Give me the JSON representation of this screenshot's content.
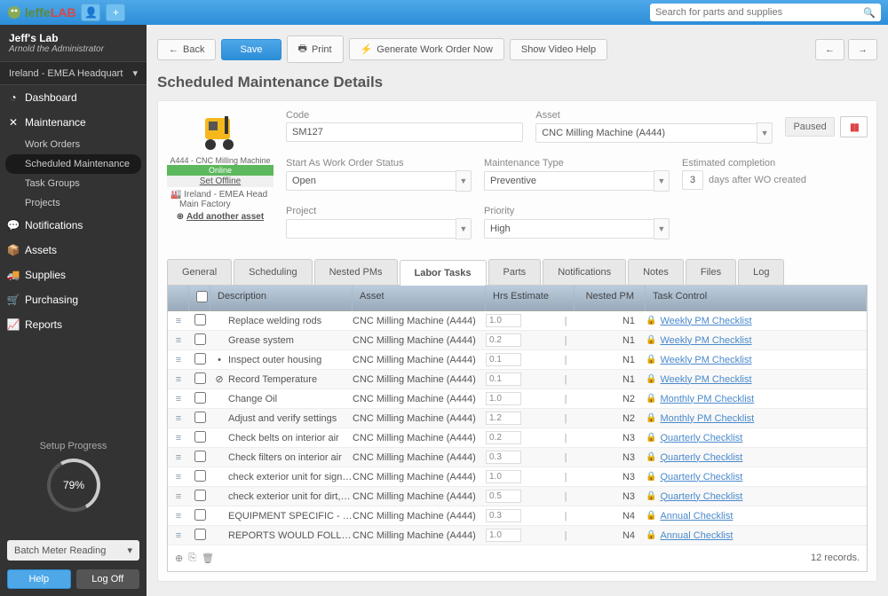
{
  "topbar": {
    "search_placeholder": "Search for parts and supplies"
  },
  "sidebar": {
    "lab_name": "Jeff's Lab",
    "admin": "Arnold the Administrator",
    "location": "Ireland - EMEA Headquart",
    "nav": [
      {
        "label": "Dashboard"
      },
      {
        "label": "Maintenance"
      },
      {
        "label": "Notifications"
      },
      {
        "label": "Assets"
      },
      {
        "label": "Supplies"
      },
      {
        "label": "Purchasing"
      },
      {
        "label": "Reports"
      }
    ],
    "maint_sub": [
      {
        "label": "Work Orders"
      },
      {
        "label": "Scheduled Maintenance"
      },
      {
        "label": "Task Groups"
      },
      {
        "label": "Projects"
      }
    ],
    "setup_label": "Setup Progress",
    "setup_pct": "79%",
    "batch_meter": "Batch Meter Reading",
    "help": "Help",
    "logoff": "Log Off"
  },
  "toolbar": {
    "back": "Back",
    "save": "Save",
    "print": "Print",
    "gen": "Generate Work Order Now",
    "video": "Show Video Help"
  },
  "page_title": "Scheduled Maintenance Details",
  "asset_preview": {
    "name": "A444 - CNC Milling Machine",
    "status": "Online",
    "set_offline": "Set Offline",
    "tree1": "Ireland - EMEA Head",
    "tree2": "Main Factory",
    "add": "Add another asset"
  },
  "fields": {
    "code_label": "Code",
    "code": "SM127",
    "asset_label": "Asset",
    "asset": "CNC Milling Machine (A444)",
    "paused": "Paused",
    "start_label": "Start As Work Order Status",
    "start": "Open",
    "maint_label": "Maintenance Type",
    "maint": "Preventive",
    "est_label": "Estimated completion",
    "est_days": "3",
    "est_after": "days after WO created",
    "project_label": "Project",
    "project": "",
    "priority_label": "Priority",
    "priority": "High"
  },
  "tabs": [
    "General",
    "Scheduling",
    "Nested PMs",
    "Labor Tasks",
    "Parts",
    "Notifications",
    "Notes",
    "Files",
    "Log"
  ],
  "active_tab": 3,
  "table": {
    "headers": {
      "desc": "Description",
      "asset": "Asset",
      "hrs": "Hrs Estimate",
      "np": "Nested PM",
      "tc": "Task Control"
    },
    "rows": [
      {
        "desc": "Replace welding rods",
        "asset": "CNC Milling Machine (A444)",
        "hrs": "1.0",
        "np": "N1",
        "tc": "Weekly PM Checklist",
        "extra": ""
      },
      {
        "desc": "Grease system",
        "asset": "CNC Milling Machine (A444)",
        "hrs": "0.2",
        "np": "N1",
        "tc": "Weekly PM Checklist",
        "extra": ""
      },
      {
        "desc": "Inspect outer housing",
        "asset": "CNC Milling Machine (A444)",
        "hrs": "0.1",
        "np": "N1",
        "tc": "Weekly PM Checklist",
        "extra": "•"
      },
      {
        "desc": "Record Temperature",
        "asset": "CNC Milling Machine (A444)",
        "hrs": "0.1",
        "np": "N1",
        "tc": "Weekly PM Checklist",
        "extra": "⊘"
      },
      {
        "desc": "Change Oil",
        "asset": "CNC Milling Machine (A444)",
        "hrs": "1.0",
        "np": "N2",
        "tc": "Monthly PM Checklist",
        "extra": ""
      },
      {
        "desc": "Adjust and verify settings",
        "asset": "CNC Milling Machine (A444)",
        "hrs": "1.2",
        "np": "N2",
        "tc": "Monthly PM Checklist",
        "extra": ""
      },
      {
        "desc": "Check belts on interior air",
        "asset": "CNC Milling Machine (A444)",
        "hrs": "0.2",
        "np": "N3",
        "tc": "Quarterly Checklist",
        "extra": ""
      },
      {
        "desc": "Check filters on interior air",
        "asset": "CNC Milling Machine (A444)",
        "hrs": "0.3",
        "np": "N3",
        "tc": "Quarterly Checklist",
        "extra": ""
      },
      {
        "desc": "check exterior unit for signs of...",
        "asset": "CNC Milling Machine (A444)",
        "hrs": "1.0",
        "np": "N3",
        "tc": "Quarterly Checklist",
        "extra": ""
      },
      {
        "desc": "check exterior unit for dirt, de...",
        "asset": "CNC Milling Machine (A444)",
        "hrs": "0.5",
        "np": "N3",
        "tc": "Quarterly Checklist",
        "extra": ""
      },
      {
        "desc": "EQUIPMENT SPECIFIC - VEND...",
        "asset": "CNC Milling Machine (A444)",
        "hrs": "0.3",
        "np": "N4",
        "tc": "Annual Checklist",
        "extra": ""
      },
      {
        "desc": "REPORTS WOULD FOLLOW AN...",
        "asset": "CNC Milling Machine (A444)",
        "hrs": "1.0",
        "np": "N4",
        "tc": "Annual Checklist",
        "extra": ""
      }
    ],
    "records": "12 records."
  }
}
